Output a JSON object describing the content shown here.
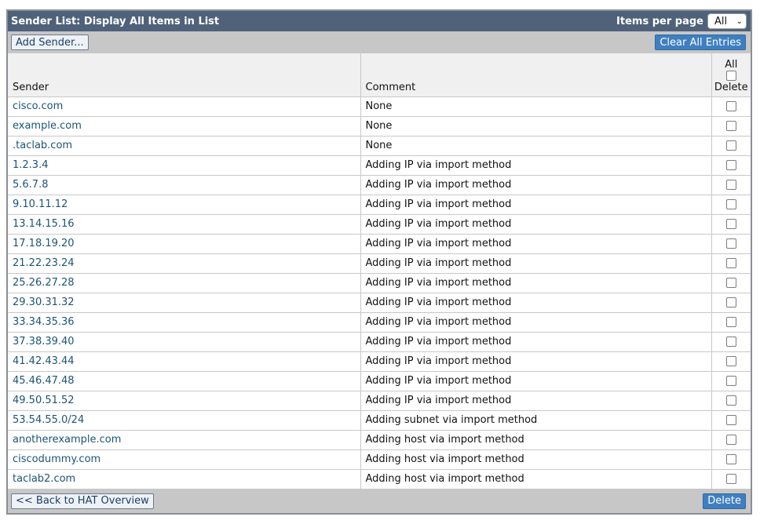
{
  "header": {
    "title": "Sender List: Display All Items in List",
    "items_per_page_label": "Items per page",
    "items_per_page_value": "All"
  },
  "toolbar": {
    "add_sender_label": "Add Sender...",
    "clear_all_label": "Clear All Entries"
  },
  "table": {
    "columns": {
      "sender": "Sender",
      "comment": "Comment",
      "all_label": "All",
      "delete_label": "Delete"
    },
    "rows": [
      {
        "sender": "cisco.com",
        "comment": "None"
      },
      {
        "sender": "example.com",
        "comment": "None"
      },
      {
        "sender": ".taclab.com",
        "comment": "None"
      },
      {
        "sender": "1.2.3.4",
        "comment": "Adding IP via import method"
      },
      {
        "sender": "5.6.7.8",
        "comment": "Adding IP via import method"
      },
      {
        "sender": "9.10.11.12",
        "comment": "Adding IP via import method"
      },
      {
        "sender": "13.14.15.16",
        "comment": "Adding IP via import method"
      },
      {
        "sender": "17.18.19.20",
        "comment": "Adding IP via import method"
      },
      {
        "sender": "21.22.23.24",
        "comment": "Adding IP via import method"
      },
      {
        "sender": "25.26.27.28",
        "comment": "Adding IP via import method"
      },
      {
        "sender": "29.30.31.32",
        "comment": "Adding IP via import method"
      },
      {
        "sender": "33.34.35.36",
        "comment": "Adding IP via import method"
      },
      {
        "sender": "37.38.39.40",
        "comment": "Adding IP via import method"
      },
      {
        "sender": "41.42.43.44",
        "comment": "Adding IP via import method"
      },
      {
        "sender": "45.46.47.48",
        "comment": "Adding IP via import method"
      },
      {
        "sender": "49.50.51.52",
        "comment": "Adding IP via import method"
      },
      {
        "sender": "53.54.55.0/24",
        "comment": "Adding subnet via import method"
      },
      {
        "sender": "anotherexample.com",
        "comment": "Adding host via import method"
      },
      {
        "sender": "ciscodummy.com",
        "comment": "Adding host via import method"
      },
      {
        "sender": "taclab2.com",
        "comment": "Adding host via import method"
      }
    ]
  },
  "footer": {
    "back_label": "<< Back to HAT Overview",
    "delete_label": "Delete"
  },
  "colors": {
    "header_bg": "#4f627a",
    "toolbar_bg": "#c7c7c7",
    "link": "#1c5476",
    "primary_button": "#3f7fbf"
  }
}
